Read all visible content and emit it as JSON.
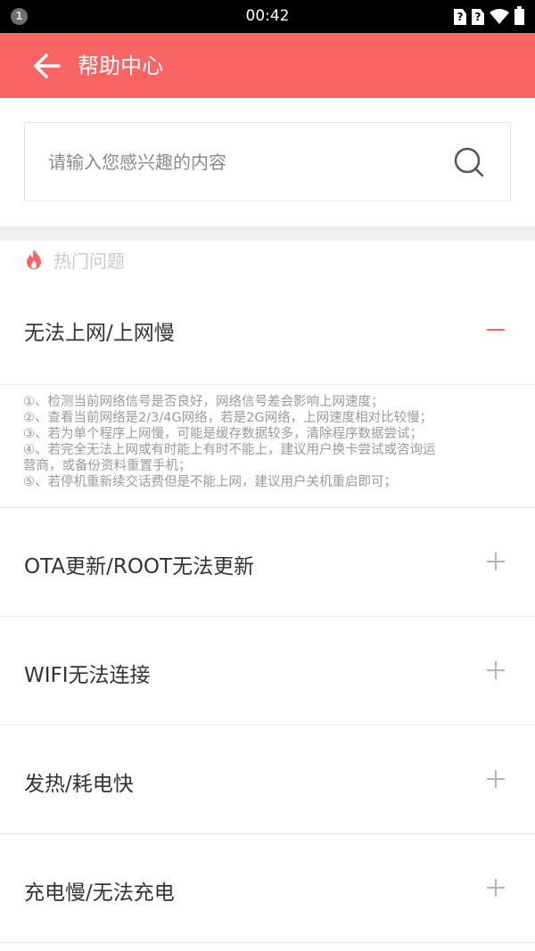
{
  "statusbar": {
    "time": "00:42",
    "notification": "1",
    "sim1": "?",
    "sim2": "?"
  },
  "header": {
    "title": "帮助中心"
  },
  "search": {
    "placeholder": "请输入您感兴趣的内容"
  },
  "hot_section": {
    "label": "热门问题"
  },
  "faqs": [
    {
      "question": "无法上网/上网慢",
      "expanded": true
    },
    {
      "question": "OTA更新/ROOT无法更新",
      "expanded": false
    },
    {
      "question": "WIFI无法连接",
      "expanded": false
    },
    {
      "question": "发热/耗电快",
      "expanded": false
    },
    {
      "question": "充电慢/无法充电",
      "expanded": false
    }
  ],
  "answer": {
    "lines": [
      "①、检测当前网络信号是否良好，网络信号差会影响上网速度；",
      "②、查看当前网络是2/3/4G网络，若是2G网络，上网速度相对比较慢；",
      "③、若为单个程序上网慢，可能是缓存数据较多，清除程序数据尝试；",
      "④、若完全无法上网或有时能上有时不能上，建议用户换卡尝试或咨询运",
      "营商，或备份资料重置手机；",
      "⑤、若停机重新续交话费但是不能上网，建议用户关机重启即可；"
    ]
  },
  "colors": {
    "accent": "#f96464",
    "divider": "#e8e8e8",
    "section_gap": "#eeeeee"
  }
}
